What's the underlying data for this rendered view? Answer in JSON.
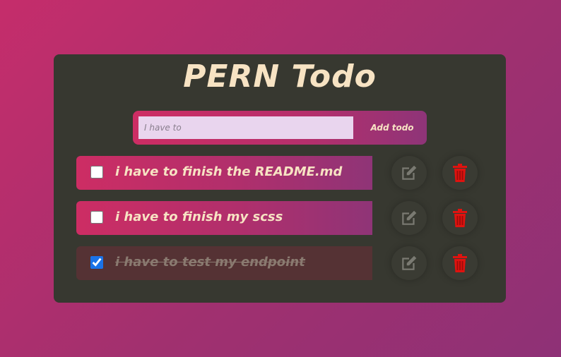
{
  "app": {
    "title": "PERN Todo"
  },
  "add_form": {
    "placeholder": "I have to",
    "button_label": "Add todo"
  },
  "todos": [
    {
      "text": "i have to finish the README.md",
      "completed": false
    },
    {
      "text": "i have to finish my scss",
      "completed": false
    },
    {
      "text": "i have to test my endpoint",
      "completed": true
    }
  ],
  "colors": {
    "background": "#b02f6c",
    "card": "#373830",
    "accent_start": "#cd2d64",
    "accent_end": "#8e3478",
    "title_text": "#f7e3c3",
    "delete_icon": "#e0120f",
    "edit_icon": "#7a7a72"
  },
  "icons": {
    "edit": "pencil-square-icon",
    "delete": "trash-icon"
  }
}
